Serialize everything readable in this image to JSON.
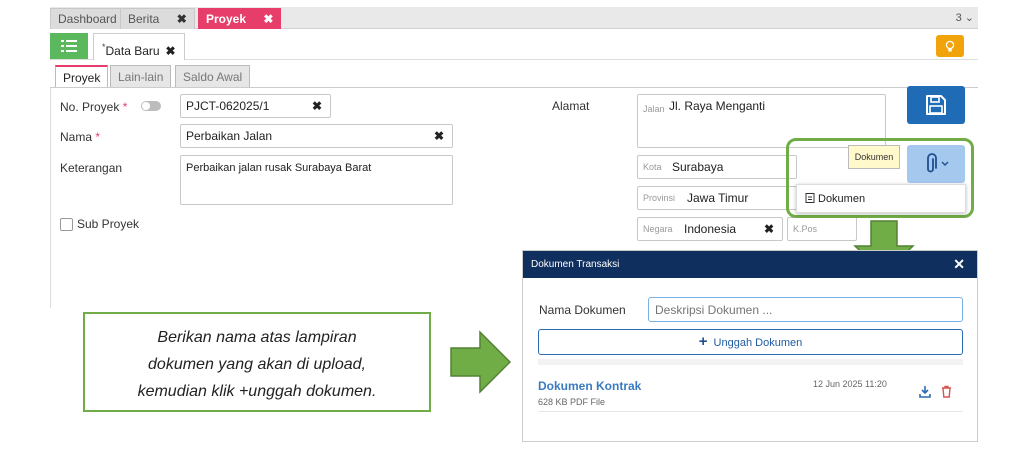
{
  "top_tabs": [
    {
      "label": "Dashboard"
    },
    {
      "label": "Berita",
      "close": "✖"
    },
    {
      "label": "Proyek",
      "close": "✖"
    }
  ],
  "tab_count": "3 ⌄",
  "doc_tab": {
    "marker": "*",
    "label": "Data Baru",
    "close": "✖"
  },
  "form_tabs": [
    "Proyek",
    "Lain-lain",
    "Saldo Awal"
  ],
  "form": {
    "no_proyek_label": "No. Proyek",
    "no_proyek_value": "PJCT-062025/1",
    "nama_label": "Nama",
    "nama_value": "Perbaikan Jalan",
    "keterangan_label": "Keterangan",
    "keterangan_value": "Perbaikan jalan rusak Surabaya Barat",
    "sub_proyek_label": "Sub Proyek",
    "required_mark": "*",
    "clear_mark": "✖"
  },
  "address": {
    "label": "Alamat",
    "jalan_label": "Jalan",
    "jalan_value": "Jl. Raya Menganti",
    "kota_label": "Kota",
    "kota_value": "Surabaya",
    "provinsi_label": "Provinsi",
    "provinsi_value": "Jawa Timur",
    "negara_label": "Negara",
    "negara_value": "Indonesia",
    "kpos_placeholder": "K.Pos"
  },
  "attach": {
    "tooltip": "Dokumen",
    "menu_item": "Dokumen"
  },
  "modal": {
    "title": "Dokumen Transaksi",
    "close": "✕",
    "name_label": "Nama Dokumen",
    "name_placeholder": "Deskripsi Dokumen ...",
    "upload_label": "Unggah Dokumen",
    "upload_plus": "+",
    "doc_title": "Dokumen Kontrak",
    "doc_meta": "628 KB PDF File",
    "doc_date": "12 Jun 2025 11:20"
  },
  "callout": {
    "line1": "Berikan nama atas lampiran",
    "line2": "dokumen yang akan di upload,",
    "line3": "kemudian klik +unggah dokumen."
  },
  "colors": {
    "accent": "#e63d6a",
    "green": "#70ad47",
    "save": "#1f6bb5",
    "modal_header": "#0f2f5e"
  }
}
